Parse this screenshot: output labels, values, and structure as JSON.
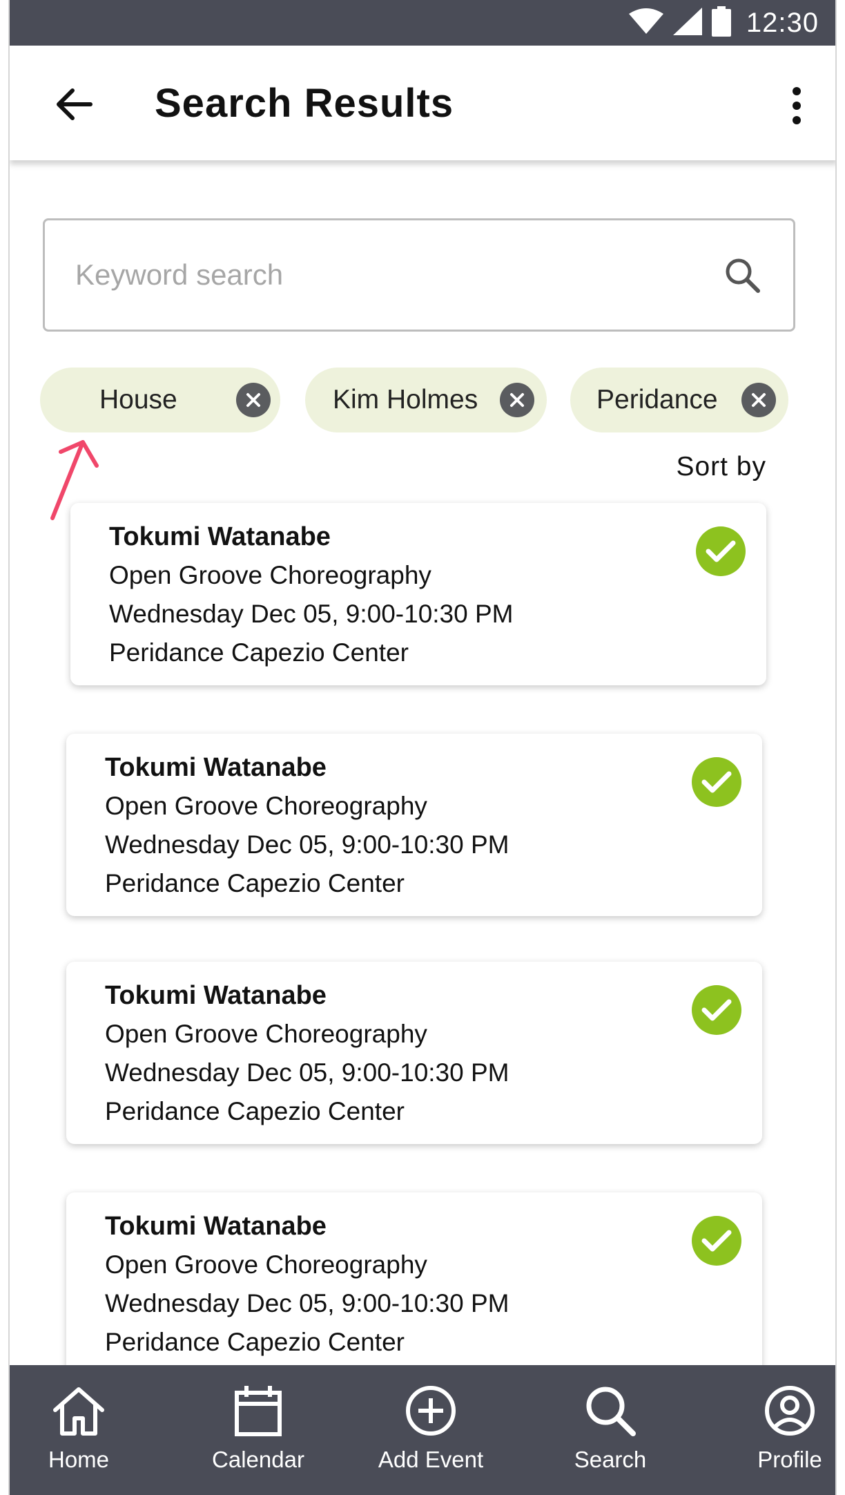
{
  "status_bar": {
    "time": "12:30"
  },
  "header": {
    "title": "Search Results"
  },
  "search": {
    "placeholder": "Keyword search",
    "value": ""
  },
  "filters": [
    {
      "label": "House"
    },
    {
      "label": "Kim Holmes"
    },
    {
      "label": "Peridance"
    }
  ],
  "sort": {
    "label": "Sort by"
  },
  "results": [
    {
      "name": "Tokumi Watanabe",
      "class": "Open Groove Choreography",
      "time": "Wednesday Dec 05, 9:00-10:30 PM",
      "location": "Peridance Capezio Center"
    },
    {
      "name": "Tokumi Watanabe",
      "class": "Open Groove Choreography",
      "time": "Wednesday Dec 05, 9:00-10:30 PM",
      "location": "Peridance Capezio Center"
    },
    {
      "name": "Tokumi Watanabe",
      "class": "Open Groove Choreography",
      "time": "Wednesday Dec 05, 9:00-10:30 PM",
      "location": "Peridance Capezio Center"
    },
    {
      "name": "Tokumi Watanabe",
      "class": "Open Groove Choreography",
      "time": "Wednesday Dec 05, 9:00-10:30 PM",
      "location": "Peridance Capezio Center"
    }
  ],
  "nav": [
    {
      "label": "Home",
      "icon": "home-icon"
    },
    {
      "label": "Calendar",
      "icon": "calendar-icon"
    },
    {
      "label": "Add Event",
      "icon": "plus-circle-icon"
    },
    {
      "label": "Search",
      "icon": "search-icon"
    },
    {
      "label": "Profile",
      "icon": "profile-icon"
    }
  ],
  "colors": {
    "bars": "#4a4c57",
    "chip_bg": "#eef2dc",
    "check": "#8dc21f",
    "annotation_arrow": "#f0476a"
  }
}
